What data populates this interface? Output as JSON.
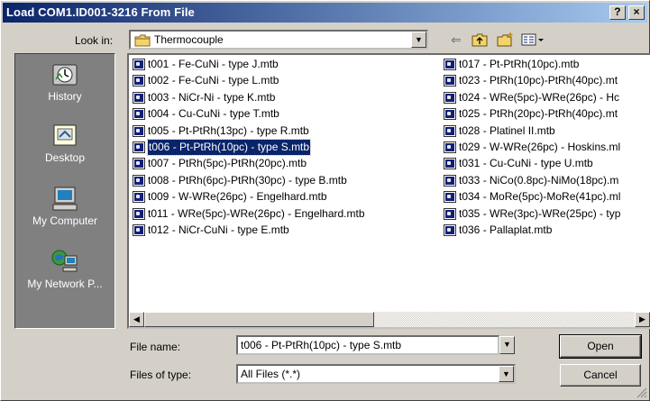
{
  "window": {
    "title": "Load COM1.ID001-3216 From File",
    "help_label": "?",
    "close_label": "×"
  },
  "look_in": {
    "label": "Look in:",
    "value": "Thermocouple"
  },
  "toolbar": {
    "icons": [
      "back-arrow-icon",
      "up-folder-icon",
      "new-folder-icon",
      "view-menu-icon"
    ]
  },
  "places": [
    {
      "label": "History",
      "icon": "history-icon"
    },
    {
      "label": "Desktop",
      "icon": "desktop-icon"
    },
    {
      "label": "My Computer",
      "icon": "computer-icon"
    },
    {
      "label": "My Network P...",
      "icon": "network-icon"
    }
  ],
  "files": {
    "column1": [
      "t001 - Fe-CuNi - type J.mtb",
      "t002 - Fe-CuNi - type L.mtb",
      "t003 - NiCr-Ni - type K.mtb",
      "t004 - Cu-CuNi - type T.mtb",
      "t005 - Pt-PtRh(13pc) - type R.mtb",
      "t006 - Pt-PtRh(10pc) - type S.mtb",
      "t007 - PtRh(5pc)-PtRh(20pc).mtb",
      "t008 - PtRh(6pc)-PtRh(30pc) - type B.mtb",
      "t009 - W-WRe(26pc) - Engelhard.mtb",
      "t011 - WRe(5pc)-WRe(26pc) - Engelhard.mtb",
      "t012 - NiCr-CuNi - type E.mtb"
    ],
    "column2": [
      "t017 - Pt-PtRh(10pc).mtb",
      "t023 - PtRh(10pc)-PtRh(40pc).mt",
      "t024 - WRe(5pc)-WRe(26pc) - Hc",
      "t025 - PtRh(20pc)-PtRh(40pc).mt",
      "t028 - Platinel II.mtb",
      "t029 - W-WRe(26pc) - Hoskins.ml",
      "t031 - Cu-CuNi - type U.mtb",
      "t033 - NiCo(0.8pc)-NiMo(18pc).m",
      "t034 - MoRe(5pc)-MoRe(41pc).ml",
      "t035 - WRe(3pc)-WRe(25pc) - typ",
      "t036 - Pallaplat.mtb"
    ],
    "selected": "t006 - Pt-PtRh(10pc) - type S.mtb"
  },
  "file_name": {
    "label": "File name:",
    "value": "t006 - Pt-PtRh(10pc) - type S.mtb"
  },
  "file_type": {
    "label": "Files of type:",
    "value": "All Files (*.*)"
  },
  "buttons": {
    "open": "Open",
    "cancel": "Cancel"
  },
  "colors": {
    "titlebar": "#0a246a",
    "selection": "#0a246a",
    "face": "#d4d0c8"
  }
}
